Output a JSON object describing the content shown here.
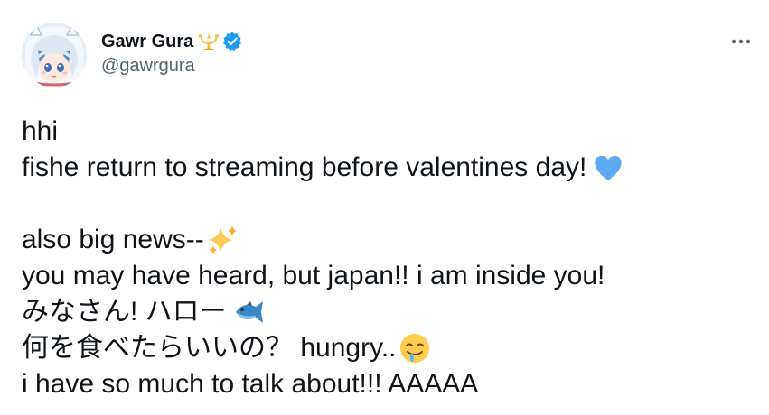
{
  "author": {
    "display_name": "Gawr Gura",
    "handle": "@gawrgura",
    "badge_icon": "trident-icon",
    "verified_icon": "verified-badge-icon"
  },
  "more_icon": "more-options-icon",
  "tweet": {
    "lines": [
      "hhi",
      "fishe return to streaming before valentines day!",
      "",
      "also big news--",
      "you may have heard, but japan!! i am inside you!",
      "みなさん! ハロー",
      "何を食べたらいいの？ hungry..",
      "i have so much to talk about!!! AAAAA"
    ],
    "emojis": {
      "line2": "blue-heart-emoji",
      "line4": "sparkles-emoji",
      "line6": "fish-emoji",
      "line7": "drooling-face-emoji"
    }
  },
  "colors": {
    "text": "#0f1419",
    "secondary": "#536471",
    "verified": "#1d9bf0",
    "blue_heart": "#5da9f0",
    "badge_gold": "#f3c14a"
  }
}
